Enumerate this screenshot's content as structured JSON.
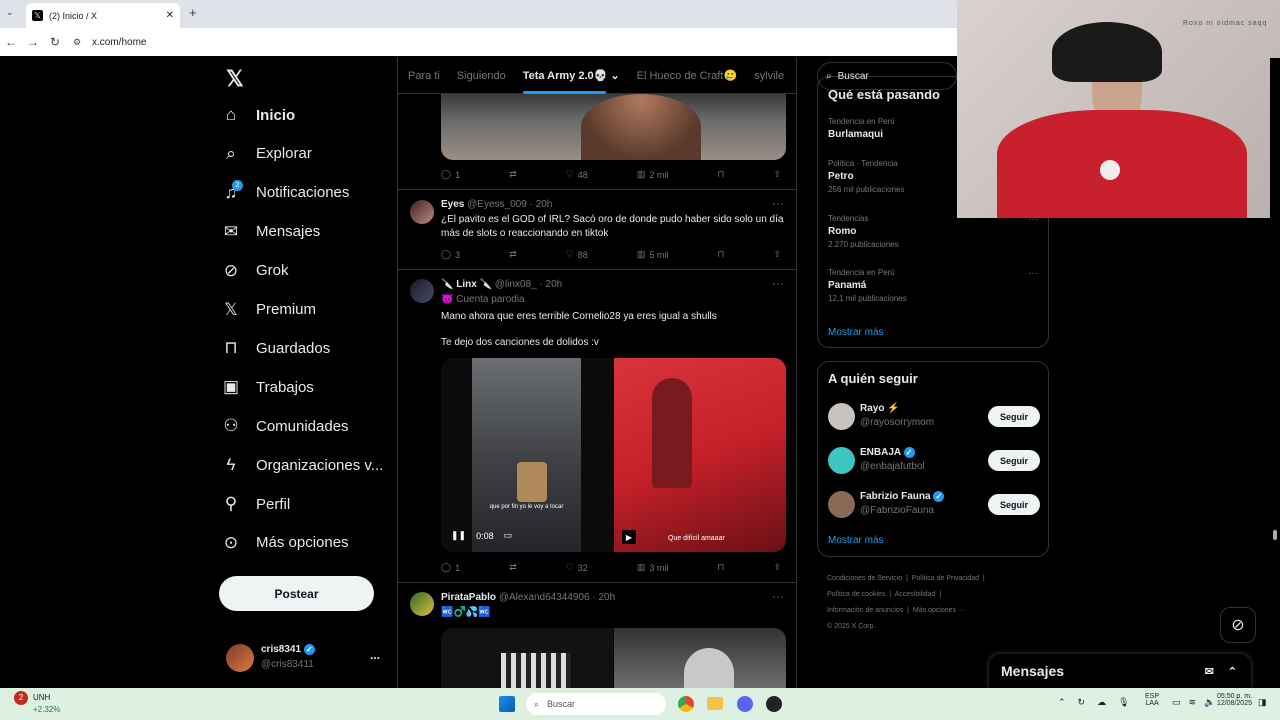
{
  "browser": {
    "tab_title": "(2) Inicio / X",
    "url": "x.com/home"
  },
  "nav": {
    "items": [
      {
        "key": "inicio",
        "label": "Inicio",
        "icon": "home-icon"
      },
      {
        "key": "explorar",
        "label": "Explorar",
        "icon": "search-icon"
      },
      {
        "key": "notificaciones",
        "label": "Notificaciones",
        "icon": "bell-icon",
        "badge": "2"
      },
      {
        "key": "mensajes",
        "label": "Mensajes",
        "icon": "mail-icon"
      },
      {
        "key": "grok",
        "label": "Grok",
        "icon": "grok-icon"
      },
      {
        "key": "premium",
        "label": "Premium",
        "icon": "x-logo-icon"
      },
      {
        "key": "guardados",
        "label": "Guardados",
        "icon": "bookmark-icon"
      },
      {
        "key": "trabajos",
        "label": "Trabajos",
        "icon": "briefcase-icon"
      },
      {
        "key": "comunidades",
        "label": "Comunidades",
        "icon": "people-icon"
      },
      {
        "key": "organizaciones",
        "label": "Organizaciones v...",
        "icon": "lightning-icon"
      },
      {
        "key": "perfil",
        "label": "Perfil",
        "icon": "person-icon"
      },
      {
        "key": "mas",
        "label": "Más opciones",
        "icon": "more-circle-icon"
      }
    ],
    "post_label": "Postear",
    "account": {
      "name": "cris8341",
      "handle": "@cris83411",
      "more": "..."
    }
  },
  "tabs": [
    "Para ti",
    "Siguiendo",
    "Teta Army 2.0💀",
    "El Hueco de Craft🥲",
    "sylvile"
  ],
  "feed": {
    "t0": {
      "replies": "1",
      "retweets": "",
      "likes": "48",
      "views": "2 mil"
    },
    "t1": {
      "name": "Eyes",
      "handle": "@Eyess_009",
      "time": "· 20h",
      "text": "¿El pavito es el GOD of IRL? Sacó oro de donde pudo haber sido solo un día más de slots o reaccionando en tiktok",
      "replies": "3",
      "retweets": "",
      "likes": "88",
      "views": "5 mil"
    },
    "t2": {
      "name": "🔪 Linx 🔪",
      "handle": "@linx08_",
      "time": "· 20h",
      "badge": "😈 Cuenta parodia",
      "text1": "Mano ahora que eres terrible Cornelio28 ya eres igual a shulls",
      "text2": "Te dejo dos canciones de dolidos :v",
      "video_time": "0:08",
      "caption1": "que por fin yo le voy a tocar",
      "caption2": "Que difícil amaaar",
      "replies": "1",
      "retweets": "",
      "likes": "32",
      "views": "3 mil"
    },
    "t3": {
      "name": "PirataPablo",
      "handle": "@Alexand64344906",
      "time": "· 20h",
      "emoji": "🚾♂️💦🚾"
    }
  },
  "right": {
    "search_placeholder": "Buscar",
    "trends_title": "Qué está pasando",
    "trends": [
      {
        "meta": "Tendencia en Perú",
        "name": "Burlamaqui",
        "count": ""
      },
      {
        "meta": "Política · Tendencia",
        "name": "Petro",
        "count": "256 mil publicaciones"
      },
      {
        "meta": "Tendencias",
        "name": "Romo",
        "count": "2.270 publicaciones"
      },
      {
        "meta": "Tendencia en Perú",
        "name": "Panamá",
        "count": "12,1 mil publicaciones"
      }
    ],
    "show_more": "Mostrar más",
    "follow_title": "A quién seguir",
    "follow": [
      {
        "name": "Rayo ⚡",
        "handle": "@rayosorrymom",
        "button": "Seguir",
        "color": "#c9c3be"
      },
      {
        "name": "ENBAJA",
        "handle": "@enbajafutbol",
        "button": "Seguir",
        "color": "#3bc6c1"
      },
      {
        "name": "Fabrizio Fauna",
        "handle": "@FabrizioFauna",
        "button": "Seguir",
        "color": "#8a6a55"
      }
    ],
    "footer": [
      "Condiciones de Servicio",
      "Política de Privacidad",
      "Política de cookies",
      "Accesibilidad",
      "Información de anuncios",
      "Más opciones ···",
      "© 2025 X Corp."
    ]
  },
  "messages_label": "Mensajes",
  "webcam_text": "Roxo ni oidmac saqq",
  "taskbar": {
    "stock_name": "UNH",
    "stock_change": "+2.32%",
    "stock_badge": "2",
    "search": "Buscar",
    "lang1": "ESP",
    "lang2": "LAA",
    "time": "05:50 p. m.",
    "date": "12/08/2025"
  }
}
